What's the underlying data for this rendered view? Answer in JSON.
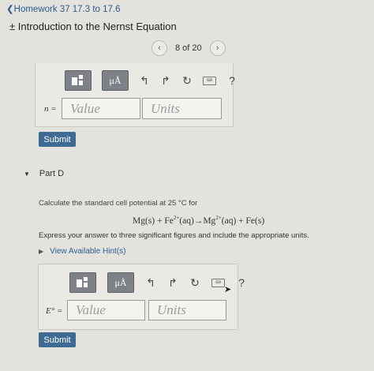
{
  "nav": {
    "back_label": "Homework 37 17.3 to 17.6"
  },
  "page": {
    "title": "Introduction to the Nernst Equation"
  },
  "pager": {
    "prev": "‹",
    "label": "8 of 20",
    "next": "›"
  },
  "toolbar": {
    "units_label": "μÅ",
    "help_label": "?",
    "undo": "↰",
    "redo": "↱",
    "reset": "↻",
    "keyboard": "⌨"
  },
  "part_c": {
    "variable_label": "n =",
    "value_placeholder": "Value",
    "units_placeholder": "Units",
    "submit_label": "Submit"
  },
  "part_d": {
    "header": "Part D",
    "question": "Calculate the standard cell potential at 25 °C for",
    "equation": {
      "t1": "Mg(s) + Fe",
      "s1": "2+",
      "t2": "(aq)→Mg",
      "s2": "2+",
      "t3": "(aq) + Fe(s)"
    },
    "instruction": "Express your answer to three significant figures and include the appropriate units.",
    "hints_label": "View Available Hint(s)",
    "variable_label": "E° =",
    "value_placeholder": "Value",
    "units_placeholder": "Units",
    "submit_label": "Submit"
  },
  "colors": {
    "accent": "#3f6a93",
    "link": "#2a5d8f",
    "toolbar_button": "#7e8187"
  }
}
